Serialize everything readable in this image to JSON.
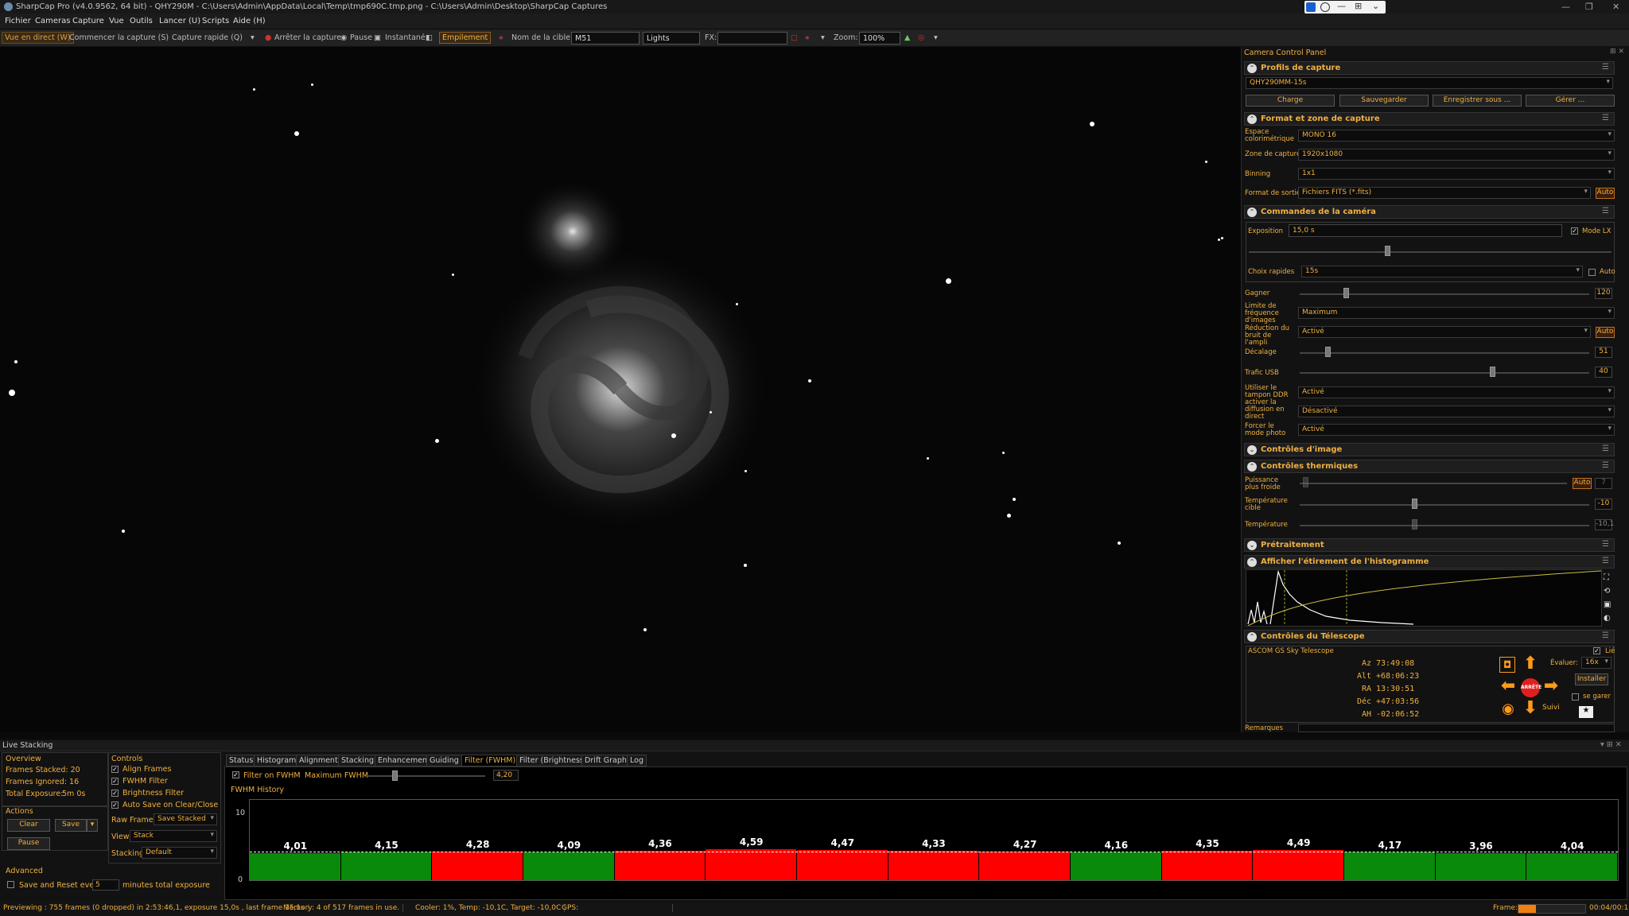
{
  "window": {
    "title": "SharpCap Pro (v4.0.9562, 64 bit) - QHY290M - C:\\Users\\Admin\\AppData\\Local\\Temp\\tmp690C.tmp.png - C:\\Users\\Admin\\Desktop\\SharpCap Captures"
  },
  "menu": [
    "Fichier",
    "Cameras",
    "Capture",
    "Vue",
    "Outils",
    "Lancer (U)",
    "Scripts",
    "Aide (H)"
  ],
  "toolbar": {
    "live": "Vue en direct (W)",
    "start": "Commencer la capture (S)",
    "quick": "Capture rapide (Q)",
    "stop": "Arrêter la capture",
    "pause": "Pause",
    "snapshot": "Instantané",
    "stack": "Empilement",
    "target_label": "Nom de la cible:",
    "target": "M51",
    "frame_type": "Lights",
    "fx_label": "FX:",
    "zoom_label": "Zoom:",
    "zoom": "100%"
  },
  "panel": {
    "title": "Camera Control Panel",
    "profiles": {
      "title": "Profils de capture",
      "profile": "QHY290MM-15s",
      "buttons": [
        "Charge",
        "Sauvegarder",
        "Enregistrer sous ...",
        "Gérer ..."
      ]
    },
    "format": {
      "title": "Format et zone de capture",
      "color_space_label": "Espace colorimétrique",
      "color_space": "MONO 16",
      "area_label": "Zone de capture",
      "area": "1920x1080",
      "binning_label": "Binning",
      "binning": "1x1",
      "output_label": "Format de sortie",
      "output": "Fichiers FITS (*.fits)",
      "auto": "Auto"
    },
    "camera": {
      "title": "Commandes de la caméra",
      "exposure_label": "Exposition",
      "exposure": "15,0 s",
      "lx_label": "Mode LX",
      "quick_label": "Choix rapides",
      "quick": "15s",
      "quick_auto": "Auto",
      "gain_label": "Gagner",
      "gain": "120",
      "framerate_label": "Limite de fréquence d'images",
      "framerate": "Maximum",
      "noise_label": "Réduction du bruit de l'ampli",
      "noise": "Activé",
      "noise_auto": "Auto",
      "offset_label": "Décalage",
      "offset": "51",
      "usb_label": "Trafic USB",
      "usb": "40",
      "ddr_label": "Utiliser le tampon DDR",
      "ddr": "Activé",
      "stream_label": "activer la diffusion en direct",
      "stream": "Désactivé",
      "photo_label": "Forcer le mode photo",
      "photo": "Activé"
    },
    "image": {
      "title": "Contrôles d'image"
    },
    "thermal": {
      "title": "Contrôles thermiques",
      "cold_label": "Puissance plus froide",
      "cold_auto": "Auto",
      "cold": "7",
      "target_label": "Température cible",
      "target": "-10",
      "temp_label": "Température",
      "temp": "-10,1"
    },
    "preprocess": {
      "title": "Prétraitement"
    },
    "histogram": {
      "title": "Afficher l'étirement de l'histogramme"
    },
    "telescope": {
      "title": "Contrôles du Télescope",
      "name": "ASCOM GS Sky Telescope",
      "linked": "Lié",
      "az_label": "Az",
      "az": "73:49:08",
      "alt_label": "Alt",
      "alt": "+68:06:23",
      "ra_label": "RA",
      "ra": "13:30:51",
      "dec_label": "Déc",
      "dec": "+47:03:56",
      "ah_label": "AH",
      "ah": "-02:06:52",
      "evaluate_label": "Évaluer:",
      "evaluate": "16x",
      "install": "Installer",
      "park": "se garer",
      "stop": "ARRÊTE",
      "follow": "Suivi"
    },
    "notes_label": "Remarques"
  },
  "stacking": {
    "title": "Live Stacking",
    "overview": {
      "title": "Overview",
      "stacked": "Frames Stacked: 20",
      "ignored": "Frames Ignored: 16",
      "exposure_label": "Total Exposure:",
      "exposure": "5m 0s"
    },
    "actions": {
      "title": "Actions",
      "clear": "Clear",
      "save": "Save",
      "pause": "Pause"
    },
    "controls": {
      "title": "Controls",
      "align": "Align Frames",
      "fwhm": "FWHM Filter",
      "brightness": "Brightness Filter",
      "autosave": "Auto Save on Clear/Close",
      "raw_label": "Raw Frames",
      "raw": "Save Stacked",
      "view_label": "View",
      "view": "Stack",
      "stacking_label": "Stacking",
      "stacking": "Default"
    },
    "advanced": {
      "title": "Advanced",
      "save_reset": "Save and Reset every",
      "minutes_value": "5",
      "minutes": "minutes total exposure"
    },
    "tabs": [
      "Status",
      "Histogram",
      "Alignment",
      "Stacking",
      "Enhancement",
      "Guiding",
      "Filter (FWHM)",
      "Filter (Brightness)",
      "Drift Graph",
      "Log"
    ],
    "filter_label": "Filter on FWHM",
    "max_label": "Maximum FWHM",
    "max_value": "4,20",
    "history_label": "FWHM History",
    "axis_top": "10",
    "axis_bottom": "0"
  },
  "chart_data": {
    "type": "bar",
    "ylim": [
      0,
      10
    ],
    "threshold": 4.2,
    "values": [
      4.01,
      4.15,
      4.28,
      4.09,
      4.36,
      4.59,
      4.47,
      4.33,
      4.27,
      4.16,
      4.35,
      4.49,
      4.17,
      3.96,
      4.04
    ],
    "labels": [
      "4,01",
      "4,15",
      "4,28",
      "4,09",
      "4,36",
      "4,59",
      "4,47",
      "4,33",
      "4,27",
      "4,16",
      "4,35",
      "4,49",
      "4,17",
      "3,96",
      "4,04"
    ],
    "colors": {
      "pass": "#0a8a0a",
      "fail": "#ff0000"
    }
  },
  "status": {
    "preview": "Previewing : 755 frames (0 dropped) in 2:53:46,1, exposure 15,0s , last frame 15,1s",
    "memory": "Memory: 4 of 517 frames in use.",
    "cooler": "Cooler: 1%, Temp: -10,1C, Target: -10,0C",
    "gps": "GPS:",
    "frame_label": "Frame:",
    "frame_time": "00:04/00:11"
  }
}
